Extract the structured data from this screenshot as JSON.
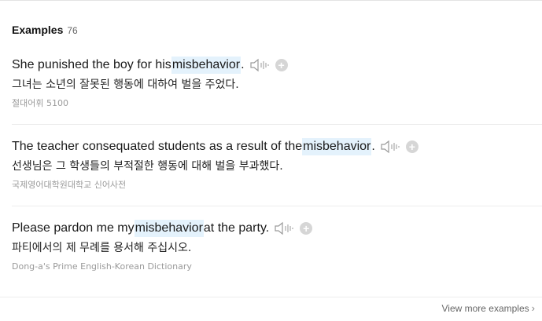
{
  "header": {
    "title": "Examples",
    "count": "76"
  },
  "examples": [
    {
      "before": "She punished the boy for his ",
      "keyword": "misbehavior",
      "after": ".",
      "translation": "그녀는 소년의 잘못된 행동에 대하여 벌을 주었다.",
      "source": "절대어휘 5100"
    },
    {
      "before": "The teacher consequated students as a result of the ",
      "keyword": "misbehavior",
      "after": ".",
      "translation": "선생님은 그 학생들의 부적절한 행동에 대해 벌을 부과했다.",
      "source": "국제영어대학원대학교 신어사전"
    },
    {
      "before": "Please pardon me my ",
      "keyword": "misbehavior",
      "after": " at the party.",
      "translation": "파티에서의 제 무례를 용서해 주십시오.",
      "source": "Dong-a's Prime English-Korean Dictionary"
    }
  ],
  "footer": {
    "more_label": "View more examples"
  },
  "icons": {
    "speaker": "speaker-icon",
    "add": "add-icon",
    "chevron": "chevron-right-icon"
  },
  "colors": {
    "highlight": "#e4f2fc",
    "add_button": "#d6d6d6",
    "source_text": "#9a9a9a"
  }
}
